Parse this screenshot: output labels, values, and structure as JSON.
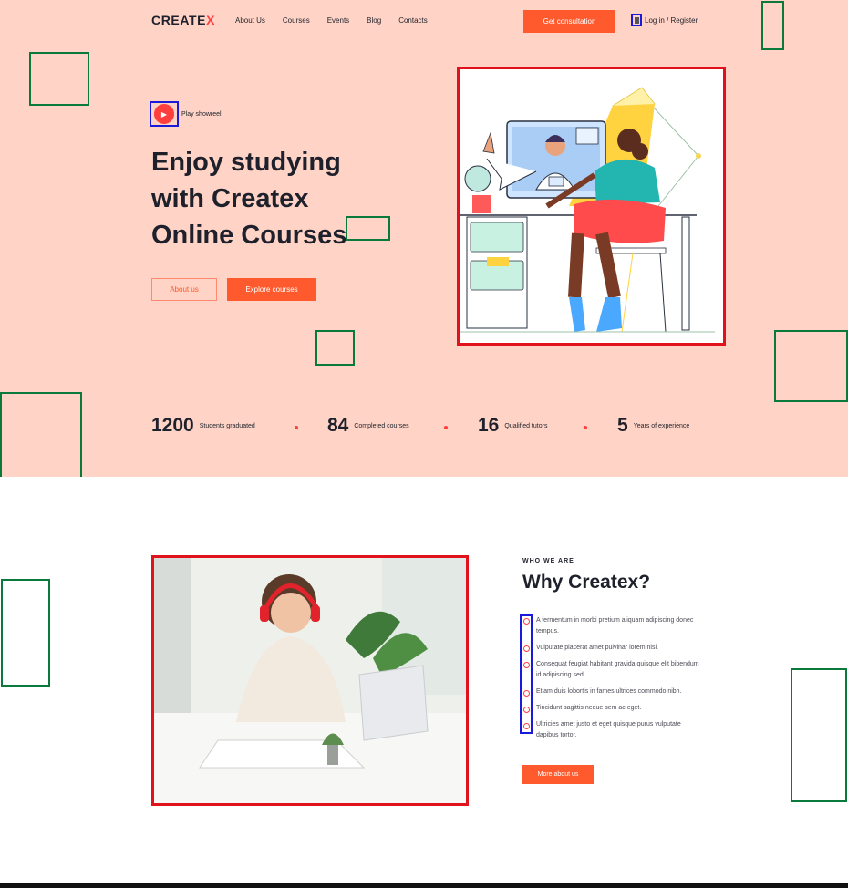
{
  "header": {
    "logo": "CREATE",
    "logo_accent": "X",
    "nav": [
      "About Us",
      "Courses",
      "Events",
      "Blog",
      "Contacts"
    ],
    "cta": "Get consultation",
    "login": "Log in / Register"
  },
  "hero": {
    "play_label": "Play showreel",
    "title_lines": [
      "Enjoy studying",
      "with Createx",
      "Online Courses"
    ],
    "btn_about": "About us",
    "btn_explore": "Explore courses"
  },
  "stats": [
    {
      "value": "1200",
      "label": "Students graduated"
    },
    {
      "value": "84",
      "label": "Completed courses"
    },
    {
      "value": "16",
      "label": "Qualified tutors"
    },
    {
      "value": "5",
      "label": "Years of experience"
    }
  ],
  "about": {
    "eyebrow": "WHO WE ARE",
    "title": "Why Createx?",
    "features": [
      "A fermentum in morbi pretium aliquam adipiscing donec tempus.",
      "Vulputate placerat amet pulvinar lorem nisl.",
      "Consequat feugiat habitant gravida quisque elit bibendum id adipiscing sed.",
      "Etiam duis lobortis in fames ultrices commodo nibh.",
      "Tincidunt sagittis neque sem ac eget.",
      "Ultricies amet justo et eget quisque purus vulputate dapibus tortor."
    ],
    "button": "More about us"
  },
  "colors": {
    "accent": "#ff5a2d",
    "hero_bg": "#ffd3c5",
    "dark": "#1e212c"
  },
  "icons": {
    "play": "play-icon",
    "login": "user-icon",
    "check": "check-circle-icon"
  }
}
